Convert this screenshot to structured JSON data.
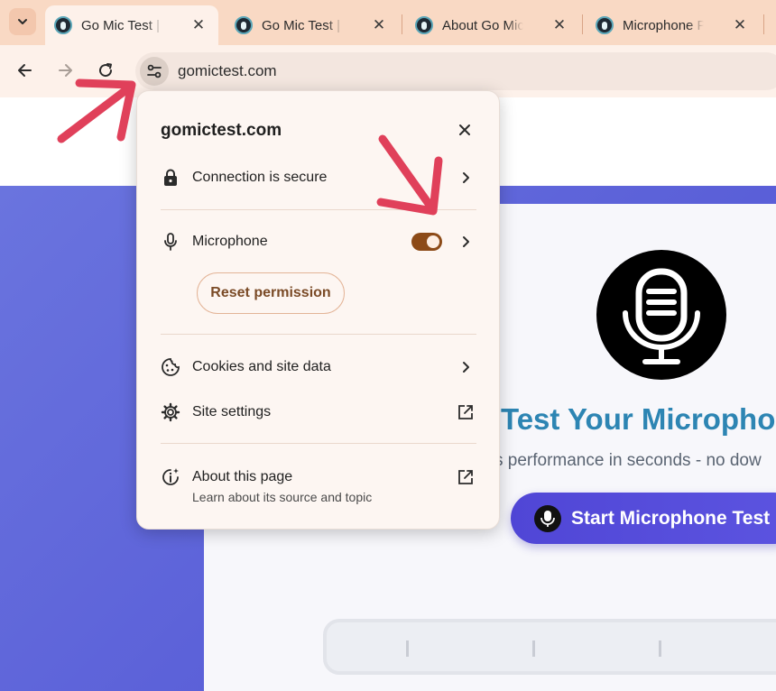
{
  "tabs": [
    {
      "title": "Go Mic Test | Free",
      "active": true
    },
    {
      "title": "Go Mic Test | Free",
      "active": false
    },
    {
      "title": "About Go Mic Test",
      "active": false
    },
    {
      "title": "Microphone Perm",
      "active": false
    }
  ],
  "tab_close_glyph": "✕",
  "omnibox": {
    "url": "gomictest.com"
  },
  "popup": {
    "domain": "gomictest.com",
    "connection_label": "Connection is secure",
    "microphone_label": "Microphone",
    "microphone_enabled": true,
    "reset_label": "Reset permission",
    "cookies_label": "Cookies and site data",
    "site_settings_label": "Site settings",
    "about_label": "About this page",
    "about_sub": "Learn about its source and topic"
  },
  "page": {
    "hero_title": "Test Your Micropho",
    "hero_sub": "s performance in seconds - no dow",
    "start_label": "Start Microphone Test"
  },
  "colors": {
    "tabstrip": "#f9d9c4",
    "toggle_on": "#8c4a17",
    "annotation_arrow": "#e0405a",
    "hero_title": "#2d85b3",
    "start_button": "#5046d6"
  }
}
